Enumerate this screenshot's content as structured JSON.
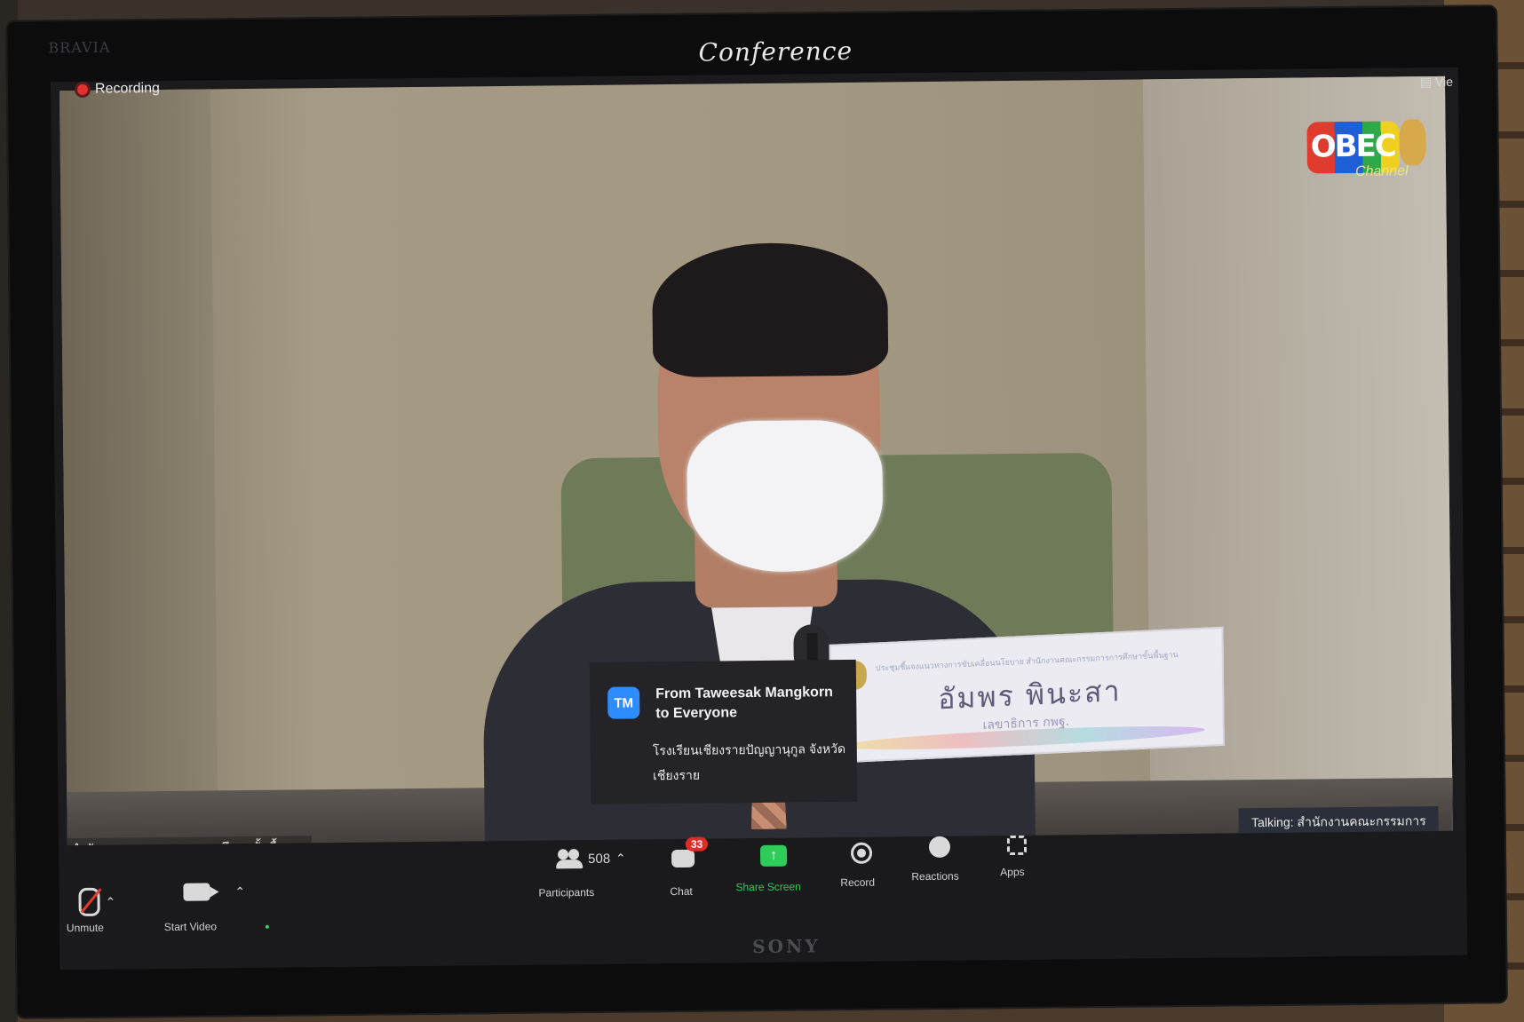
{
  "tv": {
    "brand_top": "BRAVIA",
    "brand_bottom": "SONY",
    "window_title": "Conference"
  },
  "meeting": {
    "recording_label": "Recording",
    "view_label": "Vie",
    "logo": {
      "text": "OBEC",
      "sub": "Channel"
    },
    "nameplate": {
      "header": "ประชุมชี้แจงแนวทางการขับเคลื่อนนโยบาย สำนักงานคณะกรรมการการศึกษาขั้นพื้นฐาน",
      "name": "อัมพร  พินะสา",
      "title": "เลขาธิการ กพฐ."
    },
    "speaker_name_label": "สำนักงานคณะกรรมการการศึกษาขั้นพื้นฐาน",
    "talking_label": "Talking: สำนักงานคณะกรรมการ"
  },
  "chat_popup": {
    "avatar_initials": "TM",
    "from_line1": "From Taweesak  Mangkorn",
    "from_line2": "to Everyone",
    "message_line1": "โรงเรียนเชียงรายปัญญานุกูล จังหวัด",
    "message_line2": "เชียงราย"
  },
  "toolbar": {
    "mute_label": "Unmute",
    "video_label": "Start Video",
    "participants_count": "508",
    "participants_label": "Participants",
    "chat_badge": "33",
    "chat_label": "Chat",
    "share_label": "Share Screen",
    "record_label": "Record",
    "reactions_label": "Reactions",
    "apps_label": "Apps"
  },
  "colors": {
    "zoom_blue": "#2d8cff",
    "share_green": "#2ecc59",
    "badge_red": "#e02b27",
    "recording_red": "#e0312c"
  }
}
